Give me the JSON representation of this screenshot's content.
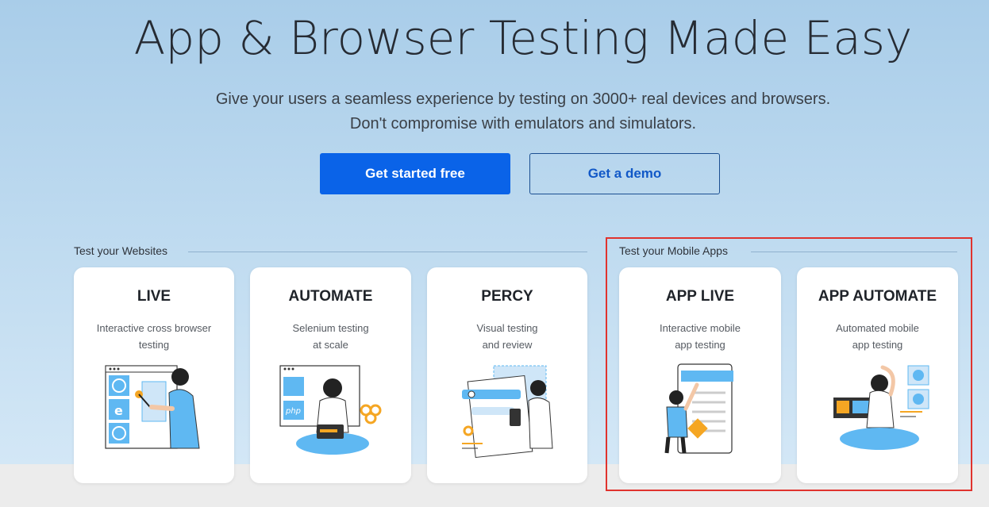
{
  "hero": {
    "title": "App & Browser Testing Made Easy",
    "subtitle_line1": "Give your users a seamless experience by testing on 3000+ real devices and browsers.",
    "subtitle_line2": "Don't compromise with emulators and simulators.",
    "primary_cta": "Get started free",
    "secondary_cta": "Get a demo"
  },
  "sections": {
    "websites_label": "Test your Websites",
    "mobile_label": "Test your Mobile Apps"
  },
  "products": [
    {
      "title": "LIVE",
      "desc1": "Interactive cross browser",
      "desc2": "testing",
      "icon": "live-illustration"
    },
    {
      "title": "AUTOMATE",
      "desc1": "Selenium testing",
      "desc2": "at scale",
      "icon": "automate-illustration"
    },
    {
      "title": "PERCY",
      "desc1": "Visual testing",
      "desc2": "and review",
      "icon": "percy-illustration"
    },
    {
      "title": "APP LIVE",
      "desc1": "Interactive mobile",
      "desc2": "app testing",
      "icon": "app-live-illustration"
    },
    {
      "title": "APP AUTOMATE",
      "desc1": "Automated mobile",
      "desc2": "app testing",
      "icon": "app-automate-illustration"
    }
  ],
  "colors": {
    "primary": "#0a63e8",
    "highlight": "#e0332e",
    "accent_orange": "#f5a623",
    "illustration_blue": "#5fb8f2"
  }
}
